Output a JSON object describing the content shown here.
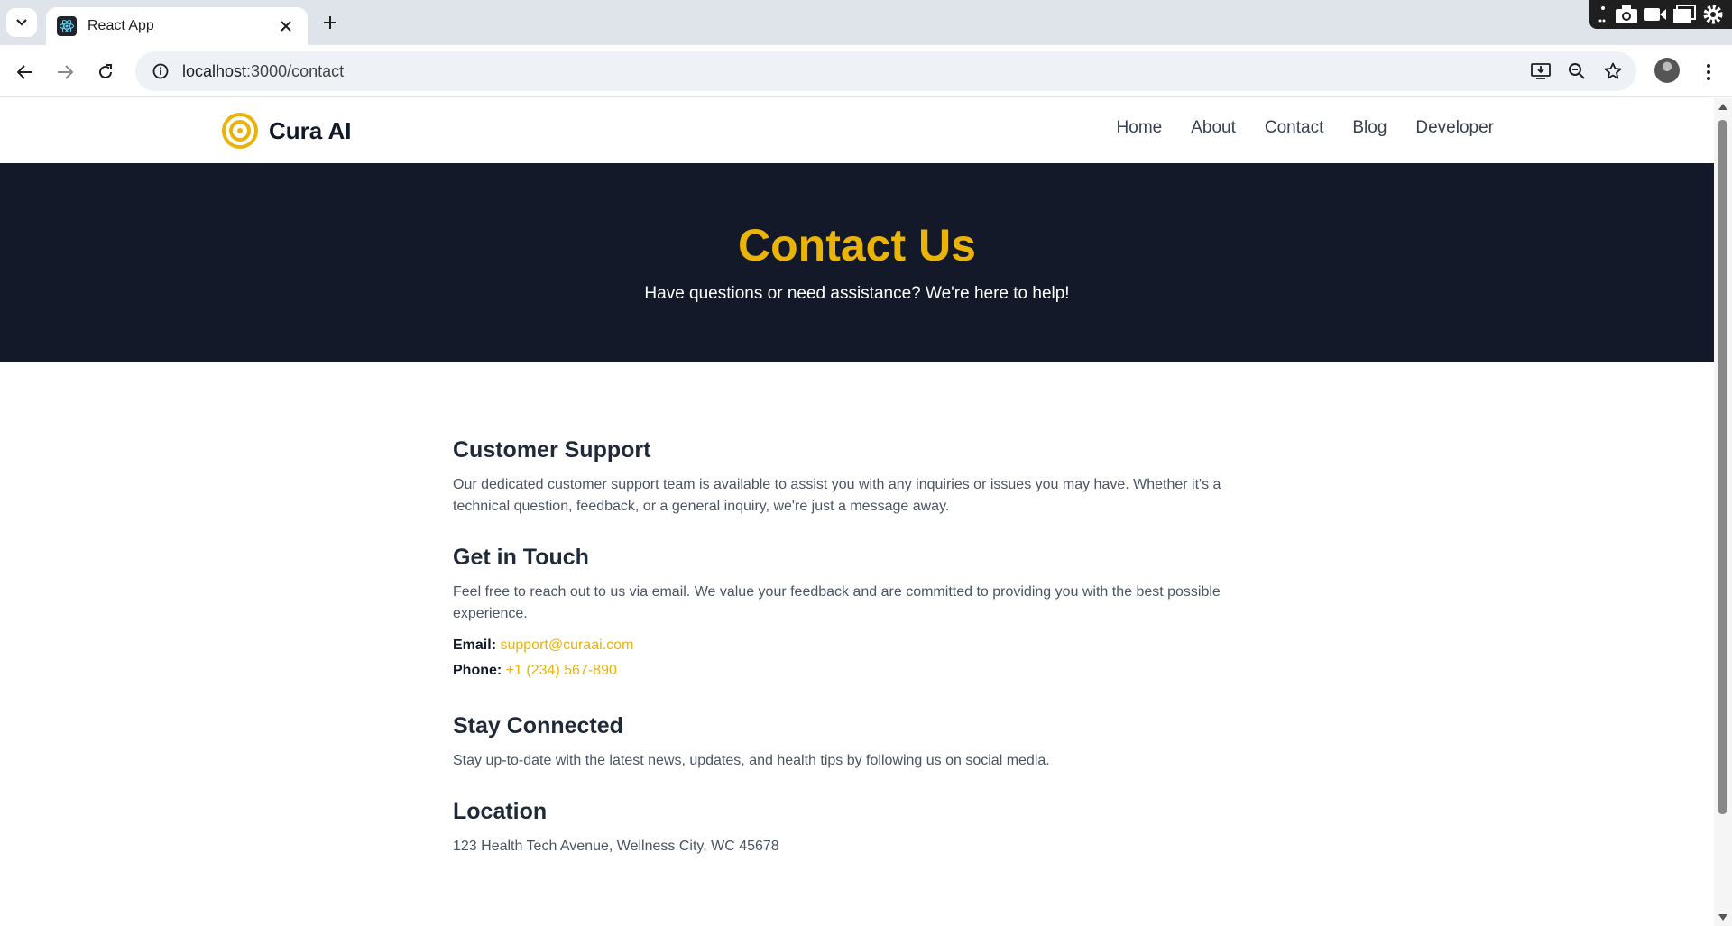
{
  "browser": {
    "tab_title": "React App",
    "url_host": "localhost",
    "url_path": ":3000/contact",
    "icons": {
      "tab_search": "chevron-down-icon",
      "close": "close-icon",
      "new_tab": "plus-icon",
      "back": "arrow-left-icon",
      "forward": "arrow-right-icon",
      "reload": "reload-icon",
      "site_info": "info-icon",
      "install": "install-app-icon",
      "zoom": "zoom-icon",
      "bookmark": "star-icon",
      "menu": "kebab-menu-icon"
    }
  },
  "site": {
    "brand_name": "Cura AI",
    "nav": [
      "Home",
      "About",
      "Contact",
      "Blog",
      "Developer"
    ],
    "accent_color": "#eab308",
    "hero_color": "#131928"
  },
  "hero": {
    "title": "Contact Us",
    "subtitle": "Have questions or need assistance? We're here to help!"
  },
  "sections": {
    "support": {
      "title": "Customer Support",
      "body": "Our dedicated customer support team is available to assist you with any inquiries or issues you may have. Whether it's a technical question, feedback, or a general inquiry, we're just a message away."
    },
    "touch": {
      "title": "Get in Touch",
      "body": "Feel free to reach out to us via email. We value your feedback and are committed to providing you with the best possible experience.",
      "email_label": "Email:",
      "email": "support@curaai.com",
      "phone_label": "Phone:",
      "phone": "+1 (234) 567-890"
    },
    "connected": {
      "title": "Stay Connected",
      "body": "Stay up-to-date with the latest news, updates, and health tips by following us on social media."
    },
    "location": {
      "title": "Location",
      "body": "123 Health Tech Avenue, Wellness City, WC 45678"
    }
  }
}
